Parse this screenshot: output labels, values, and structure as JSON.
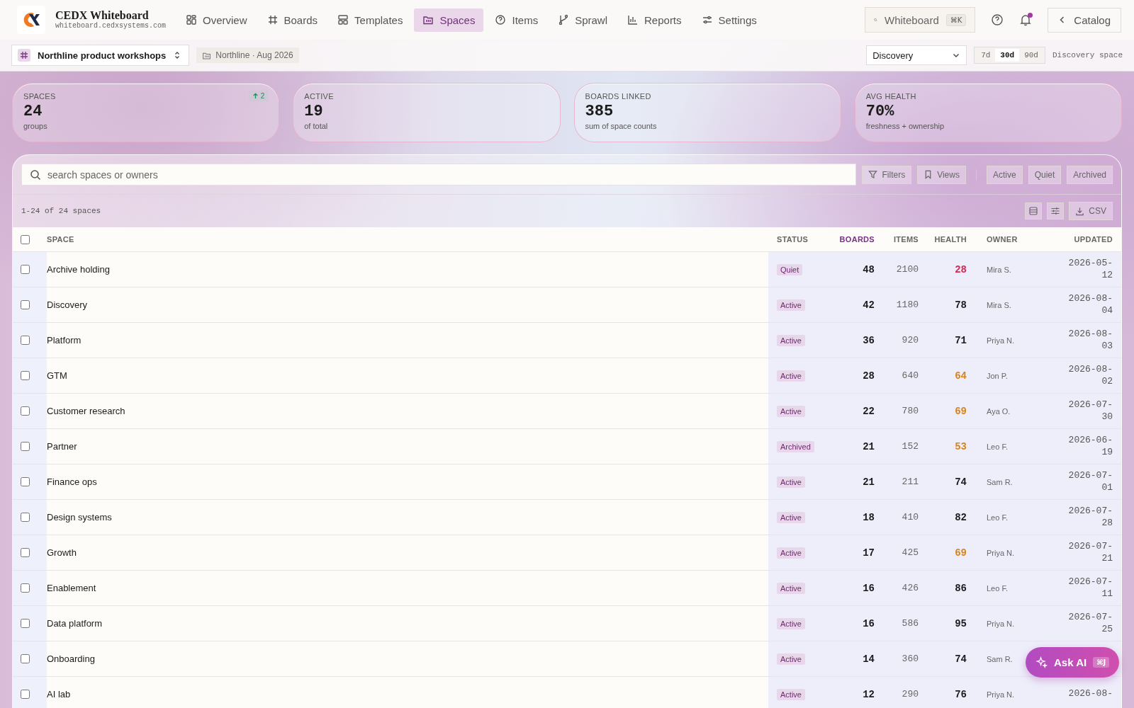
{
  "brand": {
    "name": "CEDX Whiteboard",
    "domain": "whiteboard.cedxsystems.com"
  },
  "nav": [
    {
      "label": "Overview",
      "selected": false
    },
    {
      "label": "Boards",
      "selected": false
    },
    {
      "label": "Templates",
      "selected": false
    },
    {
      "label": "Spaces",
      "selected": true
    },
    {
      "label": "Items",
      "selected": false
    },
    {
      "label": "Sprawl",
      "selected": false
    },
    {
      "label": "Reports",
      "selected": false
    },
    {
      "label": "Settings",
      "selected": false
    }
  ],
  "search": {
    "value": "Whiteboard",
    "shortcut": "⌘K"
  },
  "notifications": {
    "unread": true
  },
  "back_button": "Catalog",
  "workspace": {
    "name": "Northline product workshops",
    "tag": "Northline · Aug 2026"
  },
  "space_select": "Discovery",
  "ranges": [
    {
      "label": "7d",
      "selected": false
    },
    {
      "label": "30d",
      "selected": true
    },
    {
      "label": "90d",
      "selected": false
    }
  ],
  "space_note": "Discovery space",
  "stats": [
    {
      "label": "SPACES",
      "value": "24",
      "sub": "groups",
      "delta": "2"
    },
    {
      "label": "ACTIVE",
      "value": "19",
      "sub": "of total"
    },
    {
      "label": "BOARDS LINKED",
      "value": "385",
      "sub": "sum of space counts"
    },
    {
      "label": "AVG HEALTH",
      "value": "70%",
      "sub": "freshness + ownership"
    }
  ],
  "table_search": {
    "placeholder": "search spaces or owners"
  },
  "filters_button": "Filters",
  "views_button": "Views",
  "status_filters": [
    {
      "label": "Active",
      "selected": false
    },
    {
      "label": "Quiet",
      "selected": false
    },
    {
      "label": "Archived",
      "selected": false
    }
  ],
  "count": "1-24 of 24 spaces",
  "export_button": "CSV",
  "all_checked": false,
  "columns": [
    {
      "label": "SPACE",
      "sorted": false
    },
    {
      "label": "STATUS",
      "sorted": false
    },
    {
      "label": "BOARDS",
      "sorted": true
    },
    {
      "label": "ITEMS",
      "sorted": false
    },
    {
      "label": "HEALTH",
      "sorted": false
    },
    {
      "label": "OWNER",
      "sorted": false
    },
    {
      "label": "UPDATED",
      "sorted": false
    }
  ],
  "rows": [
    {
      "checked": false,
      "space": "Archive holding",
      "status": "Quiet",
      "boards": "48",
      "items": "2100",
      "health": "28",
      "color": "#d8264e",
      "owner": "Mira S.",
      "updated": "2026-05-12"
    },
    {
      "checked": false,
      "space": "Discovery",
      "status": "Active",
      "boards": "42",
      "items": "1180",
      "health": "78",
      "color": "#1b1b1b",
      "owner": "Mira S.",
      "updated": "2026-08-04"
    },
    {
      "checked": false,
      "space": "Platform",
      "status": "Active",
      "boards": "36",
      "items": "920",
      "health": "71",
      "color": "#1b1b1b",
      "owner": "Priya N.",
      "updated": "2026-08-03"
    },
    {
      "checked": false,
      "space": "GTM",
      "status": "Active",
      "boards": "28",
      "items": "640",
      "health": "64",
      "color": "#d9841a",
      "owner": "Jon P.",
      "updated": "2026-08-02"
    },
    {
      "checked": false,
      "space": "Customer research",
      "status": "Active",
      "boards": "22",
      "items": "780",
      "health": "69",
      "color": "#d9841a",
      "owner": "Aya O.",
      "updated": "2026-07-30"
    },
    {
      "checked": false,
      "space": "Partner",
      "status": "Archived",
      "boards": "21",
      "items": "152",
      "health": "53",
      "color": "#d9841a",
      "owner": "Leo F.",
      "updated": "2026-06-19"
    },
    {
      "checked": false,
      "space": "Finance ops",
      "status": "Active",
      "boards": "21",
      "items": "211",
      "health": "74",
      "color": "#1b1b1b",
      "owner": "Sam R.",
      "updated": "2026-07-01"
    },
    {
      "checked": false,
      "space": "Design systems",
      "status": "Active",
      "boards": "18",
      "items": "410",
      "health": "82",
      "color": "#1b1b1b",
      "owner": "Leo F.",
      "updated": "2026-07-28"
    },
    {
      "checked": false,
      "space": "Growth",
      "status": "Active",
      "boards": "17",
      "items": "425",
      "health": "69",
      "color": "#d9841a",
      "owner": "Priya N.",
      "updated": "2026-07-21"
    },
    {
      "checked": false,
      "space": "Enablement",
      "status": "Active",
      "boards": "16",
      "items": "426",
      "health": "86",
      "color": "#1b1b1b",
      "owner": "Leo F.",
      "updated": "2026-07-11"
    },
    {
      "checked": false,
      "space": "Data platform",
      "status": "Active",
      "boards": "16",
      "items": "586",
      "health": "95",
      "color": "#1b1b1b",
      "owner": "Priya N.",
      "updated": "2026-07-25"
    },
    {
      "checked": false,
      "space": "Onboarding",
      "status": "Active",
      "boards": "14",
      "items": "360",
      "health": "74",
      "color": "#1b1b1b",
      "owner": "Sam R."
    },
    {
      "checked": false,
      "space": "AI lab",
      "status": "Active",
      "boards": "12",
      "items": "290",
      "health": "76",
      "color": "#1b1b1b",
      "owner": "Priya N.",
      "updated": "2026-08-"
    }
  ],
  "ask_ai": {
    "label": "Ask AI",
    "shortcut": "⌘J"
  }
}
